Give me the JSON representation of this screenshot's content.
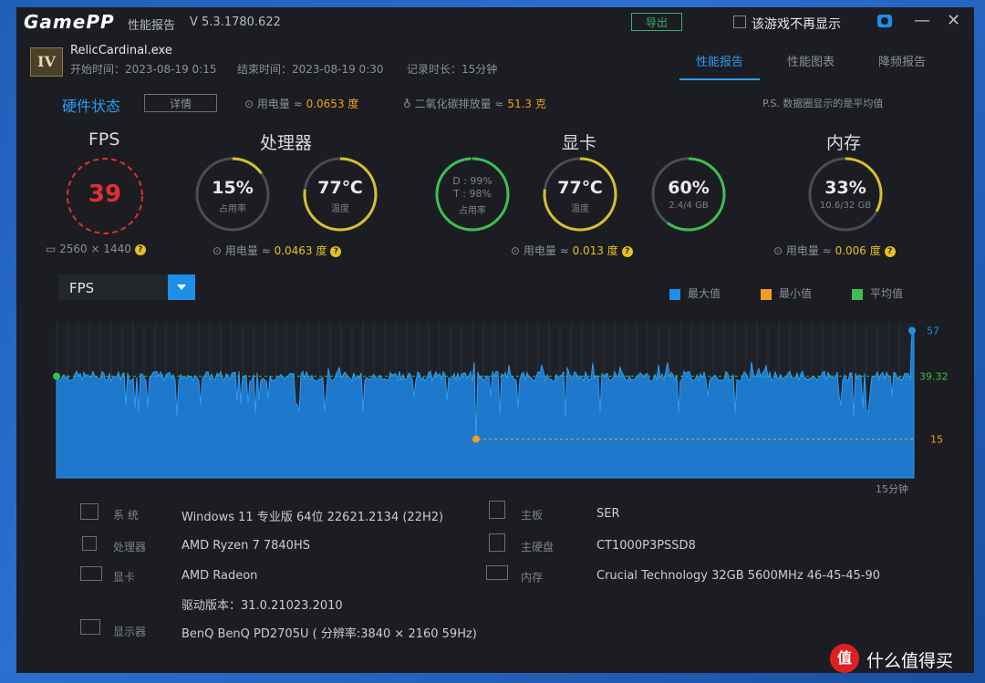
{
  "app": {
    "logo": "GamePP",
    "report_tab": "性能报告",
    "version": "V 5.3.1780.622",
    "export_label": "导出",
    "no_show_label": "该游戏不再显示"
  },
  "game": {
    "icon_text": "IV",
    "exe": "RelicCardinal.exe",
    "start": "开始时间：2023-08-19 0:15",
    "end": "结束时间：2023-08-19 0:30",
    "duration": "记录时长：15分钟"
  },
  "tabs": [
    "性能报告",
    "性能图表",
    "降频报告"
  ],
  "hardware": {
    "title": "硬件状态",
    "detail_label": "详情",
    "power_label": "用电量 ≈",
    "power_value": "0.0653 度",
    "co2_label": "二氧化碳排放量 ≈",
    "co2_value": "51.3 克",
    "note": "P.S. 数据圈显示的是平均值"
  },
  "sections": {
    "fps": "FPS",
    "cpu": "处理器",
    "gpu": "显卡",
    "mem": "内存"
  },
  "gauges": {
    "fps": {
      "value": "39"
    },
    "cpu_usage": {
      "value": "15%",
      "label": "占用率",
      "fill": 0.15
    },
    "cpu_temp": {
      "value": "77℃",
      "label": "温度",
      "fill": 0.77
    },
    "gpu_usage": {
      "line1": "D : 99%",
      "line2": "T : 98%",
      "label": "占用率",
      "fill": 0.99
    },
    "gpu_temp": {
      "value": "77℃",
      "label": "温度",
      "fill": 0.77
    },
    "gpu_mem": {
      "value": "60%",
      "label": "2.4/4 GB",
      "fill": 0.6
    },
    "mem": {
      "value": "33%",
      "label": "10.6/32 GB",
      "fill": 0.33
    }
  },
  "subrows": {
    "resolution": "2560 × 1440",
    "cpu_power_label": "用电量 ≈",
    "cpu_power": "0.0463 度",
    "gpu_power_label": "用电量 ≈",
    "gpu_power": "0.013 度",
    "mem_power_label": "用电量 ≈",
    "mem_power": "0.006 度"
  },
  "chart_select": "FPS",
  "legend": {
    "max": "最大值",
    "min": "最小值",
    "avg": "平均值"
  },
  "colors": {
    "accent": "#1e8fe8",
    "max": "#1e8fe8",
    "min": "#f0a020",
    "avg": "#3fbf4f",
    "fps_ring": "#e03030"
  },
  "chart_data": {
    "type": "area",
    "series": [
      {
        "name": "FPS"
      }
    ],
    "max": 57,
    "avg": 39.32,
    "min": 15,
    "x_end_label": "15分钟",
    "y_labels": [
      "57",
      "39.32",
      "15"
    ]
  },
  "system": {
    "os_label": "系    统",
    "os": "Windows 11 专业版 64位 22621.2134 (22H2)",
    "cpu_label": "处理器",
    "cpu": "AMD Ryzen 7 7840HS",
    "gpu_label": "显卡",
    "gpu": "AMD Radeon",
    "driver": "驱动版本：31.0.21023.2010",
    "monitor_label": "显示器",
    "monitor": "BenQ BenQ PD2705U ( 分辨率:3840 × 2160 59Hz)",
    "board_label": "主板",
    "board": "SER",
    "disk_label": "主硬盘",
    "disk": "CT1000P3PSSD8",
    "ram_label": "内存",
    "ram": "Crucial Technology 32GB 5600MHz 46-45-45-90"
  },
  "watermark": {
    "icon": "值",
    "text": "什么值得买"
  }
}
